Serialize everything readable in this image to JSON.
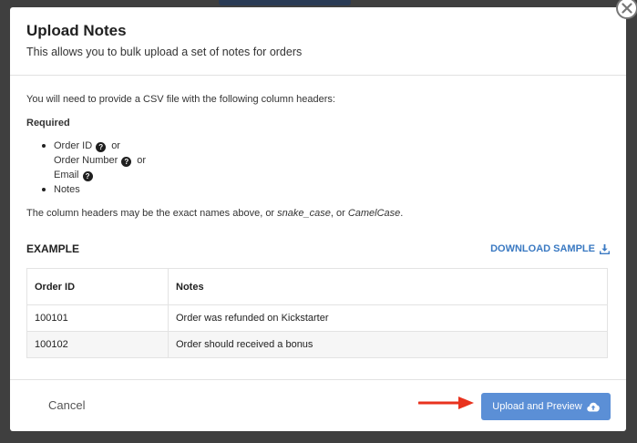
{
  "modal": {
    "title": "Upload Notes",
    "subtitle": "This allows you to bulk upload a set of notes for orders"
  },
  "body": {
    "intro": "You will need to provide a CSV file with the following column headers:",
    "required_label": "Required",
    "fields": {
      "order_id": "Order ID",
      "order_number": "Order Number",
      "email": "Email",
      "notes": "Notes",
      "or": "or"
    },
    "headers_note_prefix": "The column headers may be the exact names above, or ",
    "headers_note_snake": "snake_case",
    "headers_note_mid": ", or ",
    "headers_note_camel": "CamelCase",
    "headers_note_end": "."
  },
  "example": {
    "title": "EXAMPLE",
    "download_label": "DOWNLOAD SAMPLE",
    "columns": [
      "Order ID",
      "Notes"
    ],
    "rows": [
      [
        "100101",
        "Order was refunded on Kickstarter"
      ],
      [
        "100102",
        "Order should received a bonus"
      ]
    ]
  },
  "footer": {
    "cancel_label": "Cancel",
    "upload_label": "Upload and Preview"
  },
  "colors": {
    "accent": "#5b8fd6",
    "link": "#3a79c2",
    "arrow": "#e8321e"
  }
}
